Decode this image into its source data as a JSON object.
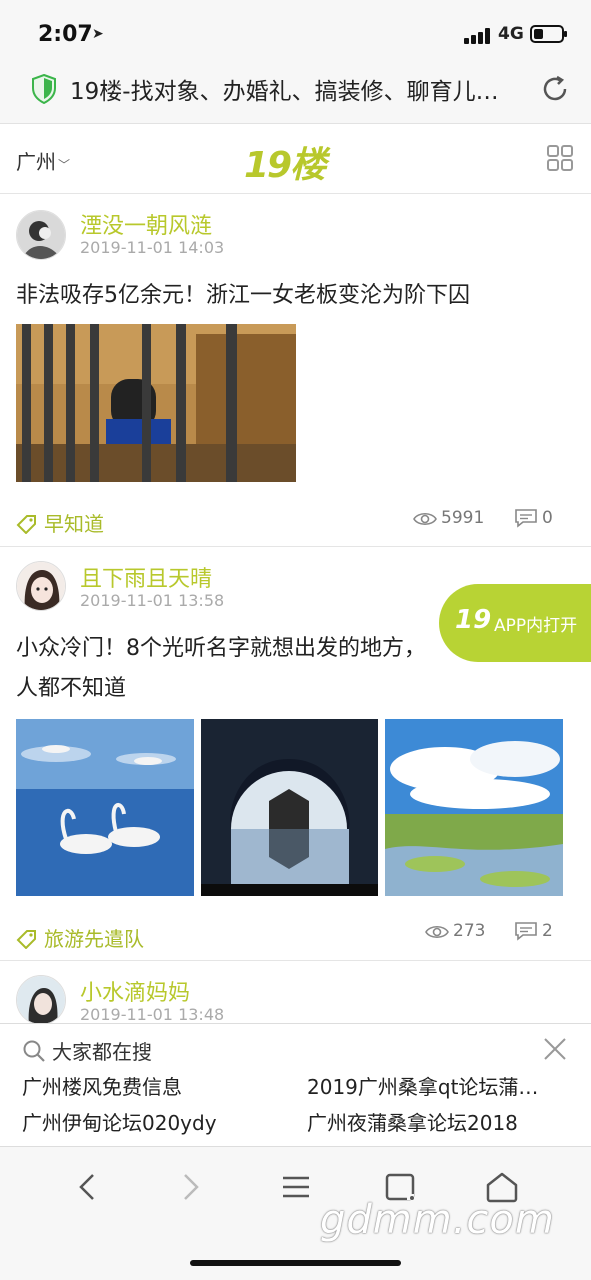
{
  "status_bar": {
    "time": "2:07",
    "network": "4G"
  },
  "url_bar": {
    "title": "19楼-找对象、办婚礼、搞装修、聊育儿…"
  },
  "header": {
    "city": "广州",
    "logo": "19楼"
  },
  "posts": [
    {
      "author": "湮没一朝风涟",
      "date": "2019-11-01 14:03",
      "title": "非法吸存5亿余元！浙江一女老板变沦为阶下囚",
      "tag": "早知道",
      "views": "5991",
      "comments": "0"
    },
    {
      "author": "且下雨且天晴",
      "date": "2019-11-01 13:58",
      "title": "小众冷门！8个光听名字就想出发的地方，人都不知道",
      "tag": "旅游先遣队",
      "views": "273",
      "comments": "2"
    },
    {
      "author": "小水滴妈妈",
      "date": "2019-11-01 13:48"
    }
  ],
  "app_badge": {
    "logo": "19",
    "label": "APP内打开"
  },
  "search_panel": {
    "title": "大家都在搜",
    "items": [
      "广州楼风免费信息",
      "2019广州桑拿qt论坛蒲…",
      "广州伊甸论坛020ydy",
      "广州夜蒲桑拿论坛2018"
    ]
  },
  "watermark": "gdmm.com",
  "colors": {
    "accent": "#b8c82c",
    "badge": "#b8d334"
  }
}
